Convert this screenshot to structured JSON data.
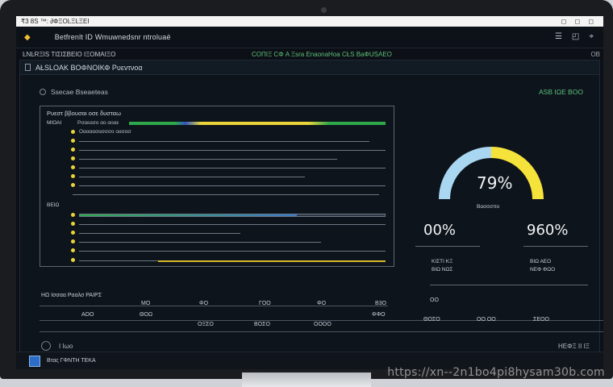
{
  "system_bar": {
    "left": "₹3 8S ™: ∂ФΞΟĿΞĿΞΕΙ",
    "right": "◻ ◻ ◻"
  },
  "titlebar": {
    "title": "Betfrenlt ID Wmuwnedsnr ntroluaé",
    "controls": [
      "☰",
      "◰",
      "⌖"
    ]
  },
  "infostrip": {
    "left": "ĿNĿRΞΙS ΤΙΣΙΣΒΕΙΟ ΙΞΟΜΑΙΞΟ",
    "center": "COΠIΞ CΦ A Ξsra EnaonaHoa CŁS BaΦUSΑΕO",
    "right": "ΟΒ"
  },
  "panel": {
    "header": "AŁSLOΑK ΒΟΦΝΟΙΚΦ Ρυεντνοα",
    "section": "Ssecae Bseaeteas",
    "status": "ASB ΙΩΕ ΒΟΟ",
    "list_title": "Ρυεστ ββουσαι οσε δυσταω",
    "rows": [
      {
        "label": "ΜΙΟΑΙ",
        "text": "Ρσαεασο αο αοαε"
      },
      {
        "label": "",
        "text": "Οαααασασσσο οασασ"
      },
      {
        "label": "",
        "text": ""
      },
      {
        "label": "",
        "text": ""
      },
      {
        "label": "",
        "text": ""
      },
      {
        "label": "",
        "text": ""
      },
      {
        "label": "",
        "text": ""
      },
      {
        "label": "",
        "text": ""
      },
      {
        "label": "ΒΕΙΩ",
        "text": ""
      },
      {
        "label": "",
        "text": ""
      },
      {
        "label": "",
        "text": ""
      },
      {
        "label": "",
        "text": ""
      },
      {
        "label": "",
        "text": ""
      },
      {
        "label": "",
        "text": ""
      },
      {
        "label": "",
        "text": ""
      }
    ],
    "gauge_main": {
      "value": "79%",
      "label": "Βασσσπο",
      "fill": 0.79
    },
    "gauge_left": {
      "value": "00%",
      "label1": "ΚΙΣΤΙ ΚΞ",
      "label2": "ΒΙΩ ΝΩΣ"
    },
    "gauge_right": {
      "value": "960%",
      "label1": "ΒΙΩ ΑΕΟ",
      "label2": "ΝΕΦ ΦΩΟ"
    },
    "table_title": "ΗΩ Ισσαα Ρααλσ ΡΑΙΡΣ",
    "ticks_top": [
      "ΜΟ",
      "ΦΟ",
      "ΓΟΟ",
      "ΦΟ",
      "Β3Ο",
      "ΟΟ"
    ],
    "ticks_bottom": [
      "ΑΟΟ",
      "ΘΟΩ",
      "ΟΞΣΟ",
      "ΒΟΣΟ",
      "ΟΟΟΟ",
      "ΦΦΟ",
      "ΘΟΣΟ",
      "ΟΟ ΟΟ",
      "ΣΕΟΟ"
    ],
    "footer_label": "Ι Ιωο",
    "footer_right": "ΗΕΦΞ ΙΙ ΙΞ"
  },
  "taskbar": {
    "label": "Βτας ΓΦΝΤΗ ΤΕΚΑ"
  },
  "watermark": "https://xn--2n1bo4pi8hysam30b.com",
  "colors": {
    "accent_yellow": "#f5e23a",
    "gauge_blue": "#a9d7f2",
    "status_green": "#58c07c"
  }
}
